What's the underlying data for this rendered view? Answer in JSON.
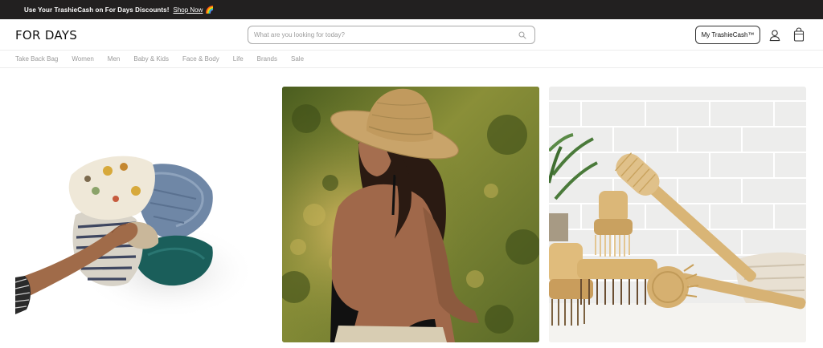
{
  "promo": {
    "text": "Use Your TrashieCash on For Days Discounts!",
    "link": "Shop Now",
    "emoji": "🌈"
  },
  "header": {
    "logo": "FOR DAYS",
    "search_placeholder": "What are you looking for today?",
    "trashie_button": "My TrashieCash™"
  },
  "nav": {
    "items": [
      "Take Back Bag",
      "Women",
      "Men",
      "Baby & Kids",
      "Face & Body",
      "Life",
      "Brands",
      "Sale"
    ]
  },
  "colors": {
    "promo_bg": "#222020",
    "nav_text": "#9a9a9a",
    "border": "#a9a9a9"
  },
  "icons": {
    "search": "search-icon",
    "account": "user-icon",
    "cart": "shopping-bag-icon"
  },
  "tiles": [
    {
      "name": "clothing-pile-photo"
    },
    {
      "name": "woman-in-sun-hat-photo"
    },
    {
      "name": "bamboo-brushes-photo"
    }
  ]
}
